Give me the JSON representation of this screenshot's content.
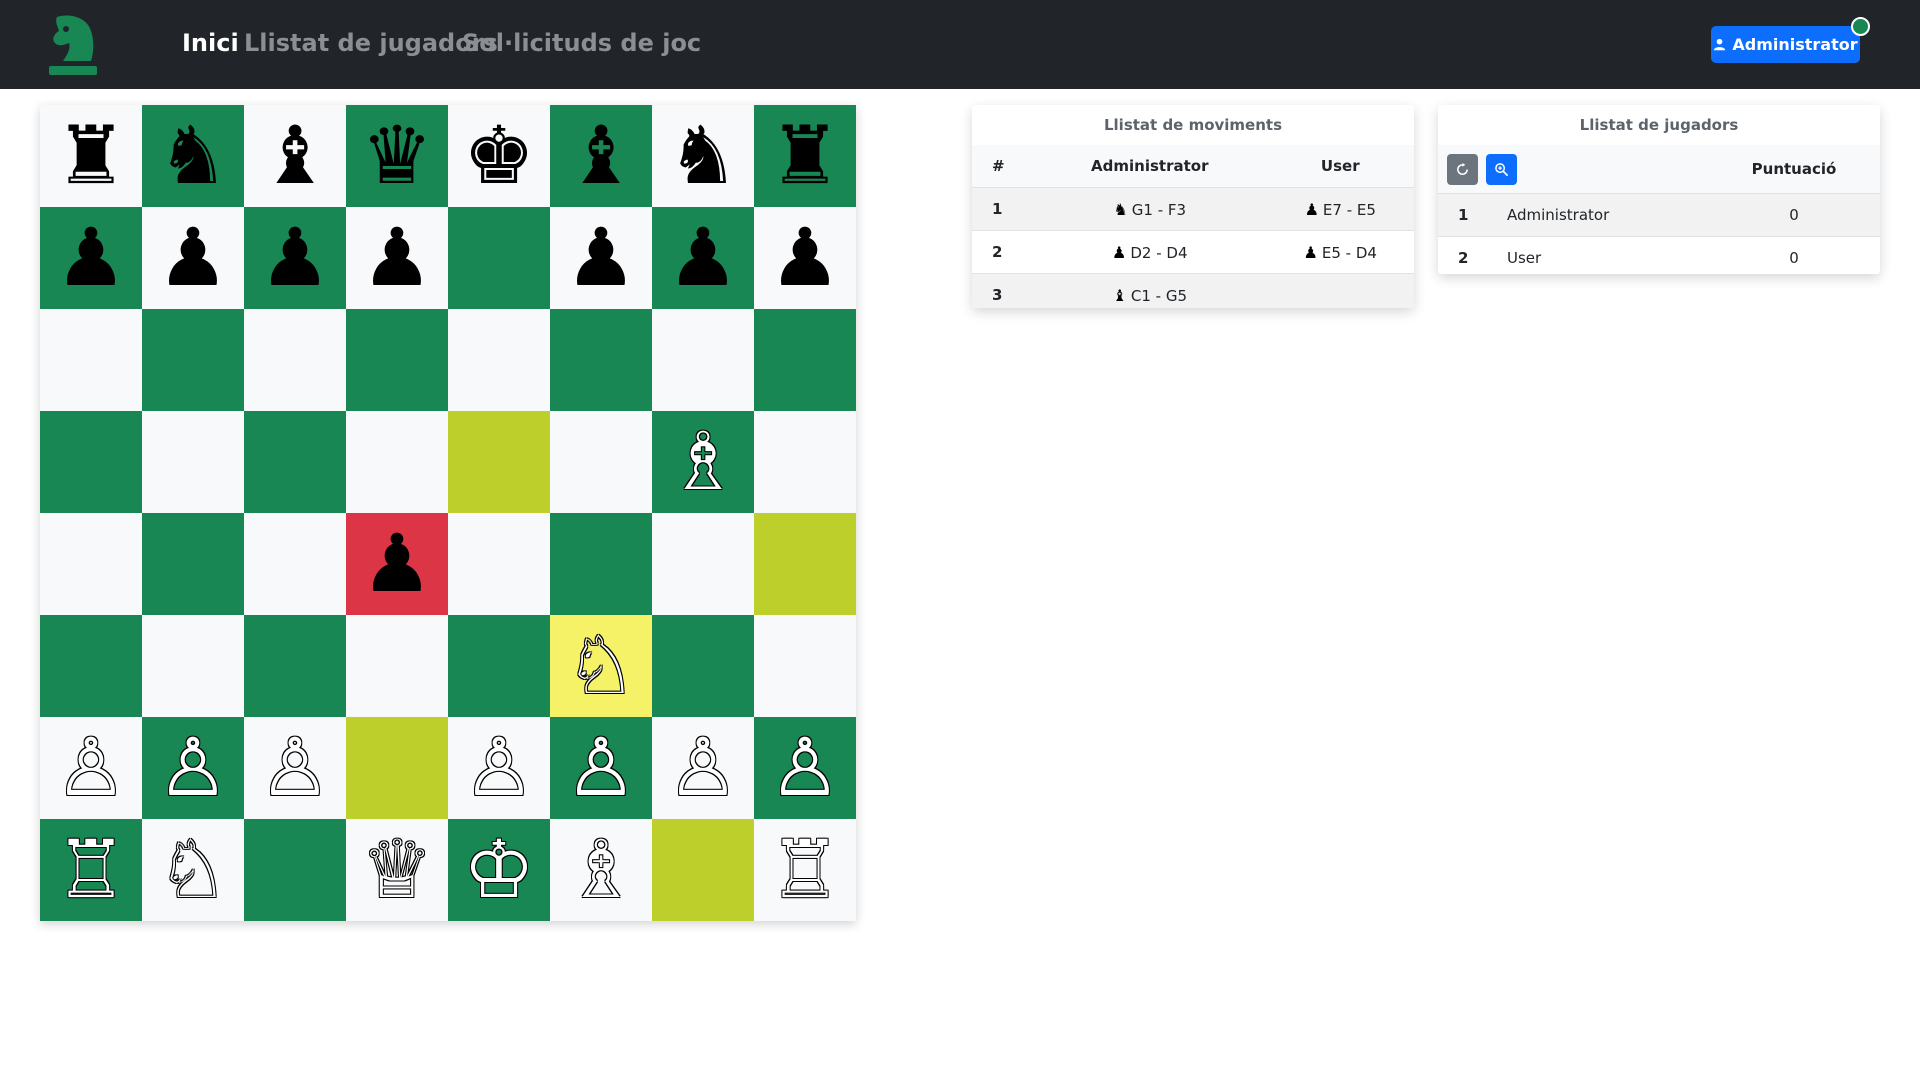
{
  "navbar": {
    "links": [
      "Inici",
      "Llistat de jugadors",
      "Sol·licituds de joc"
    ],
    "active": "Inici",
    "user_button": "Administrator",
    "status_color": "#198754",
    "logo_icon": "chess-knight-logo"
  },
  "board": {
    "light_color": "#f8f9fa",
    "dark_color": "#198754",
    "highlight_move_color": "#bccf2a",
    "highlight_selected_color": "#f6f268",
    "highlight_danger_color": "#dc3545",
    "rows": [
      [
        "br",
        "bn",
        "bb",
        "bq",
        "bk",
        "bb",
        "bn",
        "br"
      ],
      [
        "bp",
        "bp",
        "bp",
        "bp",
        "",
        "bp",
        "bp",
        "bp"
      ],
      [
        "",
        "",
        "",
        "",
        "",
        "",
        "",
        ""
      ],
      [
        "",
        "",
        "",
        "",
        "",
        "",
        "wb",
        ""
      ],
      [
        "",
        "",
        "",
        "bp",
        "",
        "",
        "",
        ""
      ],
      [
        "",
        "",
        "",
        "",
        "",
        "wn",
        "",
        ""
      ],
      [
        "wp",
        "wp",
        "wp",
        "",
        "wp",
        "wp",
        "wp",
        "wp"
      ],
      [
        "wr",
        "wn",
        "",
        "wq",
        "wk",
        "wb",
        "",
        "wr"
      ]
    ],
    "highlights": {
      "3-4": "move",
      "4-7": "move",
      "6-3": "move",
      "7-6": "move",
      "5-5": "selected",
      "4-3": "danger"
    }
  },
  "moves": {
    "title": "Llistat de moviments",
    "headers": [
      "#",
      "Administrator",
      "User"
    ],
    "rows": [
      {
        "n": "1",
        "white_icon": "knight-icon",
        "white": "G1 - F3",
        "black_icon": "pawn-icon",
        "black": "E7 - E5"
      },
      {
        "n": "2",
        "white_icon": "pawn-icon",
        "white": "D2 - D4",
        "black_icon": "pawn-icon",
        "black": "E5 - D4"
      },
      {
        "n": "3",
        "white_icon": "bishop-icon",
        "white": "C1 - G5",
        "black_icon": "",
        "black": ""
      }
    ]
  },
  "players": {
    "title": "Llistat de jugadors",
    "score_header": "Puntuació",
    "refresh_icon": "refresh-icon",
    "search_icon": "zoom-in-icon",
    "rows": [
      {
        "n": "1",
        "name": "Administrator",
        "score": "0"
      },
      {
        "n": "2",
        "name": "User",
        "score": "0"
      }
    ]
  }
}
